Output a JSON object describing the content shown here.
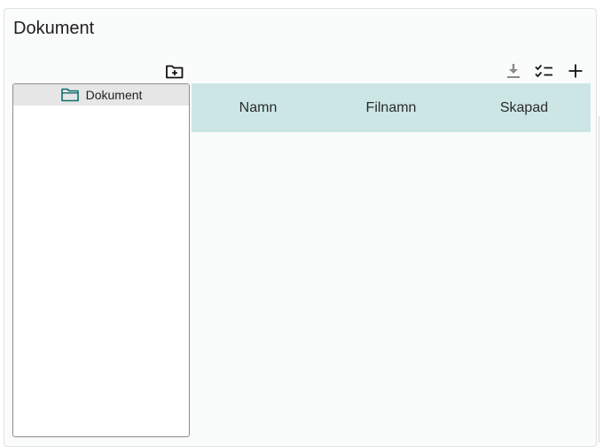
{
  "page": {
    "title": "Dokument"
  },
  "toolbar": {
    "new_folder_icon": "folder-plus-icon",
    "download_icon": "download-icon",
    "select_list_icon": "checklist-icon",
    "add_icon": "plus-icon"
  },
  "tree": {
    "items": [
      {
        "label": "Dokument",
        "icon": "folder-outline-icon",
        "selected": true
      }
    ]
  },
  "table": {
    "columns": [
      "Namn",
      "Filnamn",
      "Skapad"
    ],
    "rows": []
  },
  "colors": {
    "accent": "#0f6e6e",
    "header_bg": "#cce6e6"
  }
}
